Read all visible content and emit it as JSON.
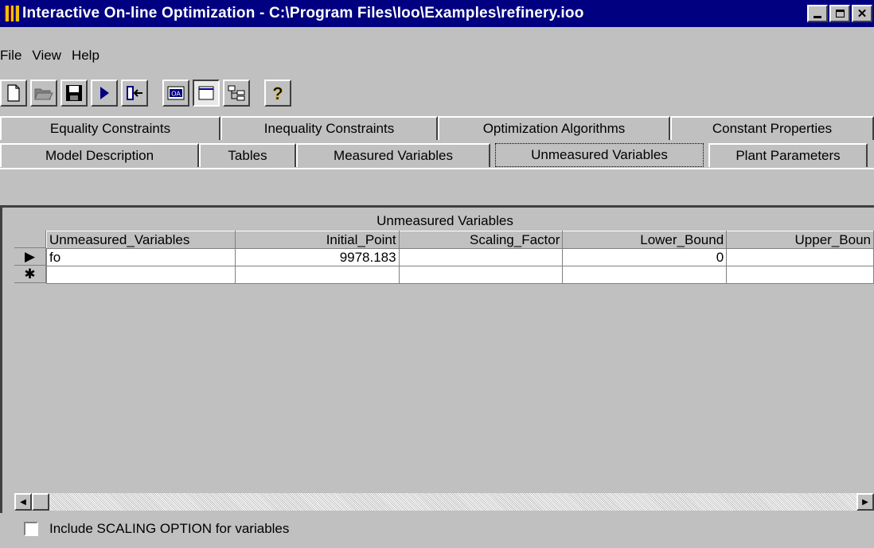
{
  "window": {
    "title": "Interactive On-line Optimization - C:\\Program Files\\Ioo\\Examples\\refinery.ioo"
  },
  "menu": {
    "items": [
      "File",
      "View",
      "Help"
    ]
  },
  "toolbar": {
    "buttons": [
      "new-file-icon",
      "open-folder-icon",
      "save-icon",
      "run-icon",
      "exit-icon",
      "oa-icon",
      "blank-page-icon",
      "tree-icon",
      "help-icon"
    ]
  },
  "tabs": {
    "row1": [
      "Equality Constraints",
      "Inequality Constraints",
      "Optimization Algorithms",
      "Constant Properties"
    ],
    "row2": [
      "Model Description",
      "Tables",
      "Measured Variables",
      "Unmeasured Variables",
      "Plant Parameters"
    ],
    "active": "Unmeasured Variables"
  },
  "grid": {
    "caption": "Unmeasured Variables",
    "columns": [
      "Unmeasured_Variables",
      "Initial_Point",
      "Scaling_Factor",
      "Lower_Bound",
      "Upper_Boun"
    ],
    "rows": [
      {
        "indicator": "▶",
        "cells": [
          "fo",
          "9978.183",
          "",
          "0",
          ""
        ]
      },
      {
        "indicator": "✱",
        "cells": [
          "",
          "",
          "",
          "",
          ""
        ]
      }
    ]
  },
  "options": {
    "scaling_label": "Include SCALING OPTION for variables",
    "scaling_checked": false
  }
}
